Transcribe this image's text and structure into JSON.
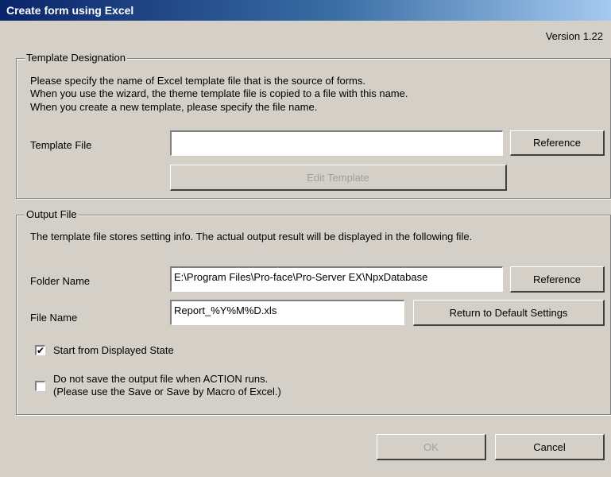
{
  "window": {
    "title": "Create form using Excel",
    "version": "Version 1.22"
  },
  "template_section": {
    "title": "Template Designation",
    "description": [
      "Please specify the name of Excel template file that is the source of forms.",
      "When you use the wizard, the theme template file is copied to a file with this name.",
      "When you create a new template, please specify the file name."
    ],
    "template_file_label": "Template File",
    "template_file_value": "",
    "reference_label": "Reference",
    "edit_template_label": "Edit Template"
  },
  "output_section": {
    "title": "Output File",
    "description": "The template file stores setting info. The actual output result will be displayed in the following file.",
    "folder_label": "Folder Name",
    "folder_value": "E:\\Program Files\\Pro-face\\Pro-Server EX\\NpxDatabase",
    "folder_reference_label": "Reference",
    "file_label": "File Name",
    "file_value": "Report_%Y%M%D.xls",
    "default_settings_label": "Return to Default Settings",
    "start_displayed": {
      "label": "Start from Displayed State",
      "checked": true
    },
    "no_save": {
      "label_line1": "Do not save the output file when ACTION runs.",
      "label_line2": "(Please use the Save or Save by Macro of Excel.)",
      "checked": false
    }
  },
  "footer": {
    "ok_label": "OK",
    "cancel_label": "Cancel"
  }
}
